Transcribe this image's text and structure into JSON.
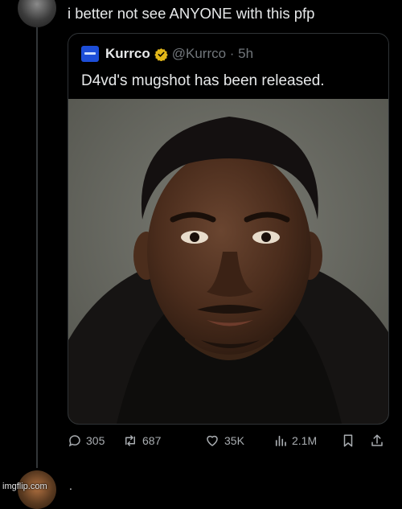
{
  "post": {
    "text": "i better not see ANYONE with this pfp"
  },
  "quote": {
    "name": "Kurrco",
    "handle_time": "@Kurrco · 5h",
    "text": "D4vd's mugshot has been released.",
    "image_alt": "mugshot photo"
  },
  "actions": {
    "replies": "305",
    "reposts": "687",
    "likes": "35K",
    "views": "2.1M"
  },
  "reply": {
    "text": "."
  },
  "watermark": "imgflip.com",
  "colors": {
    "background": "#000000",
    "text": "#e7e9ea",
    "muted": "#71767b",
    "verified_badge": "#e2b719",
    "border": "#2f3336"
  }
}
